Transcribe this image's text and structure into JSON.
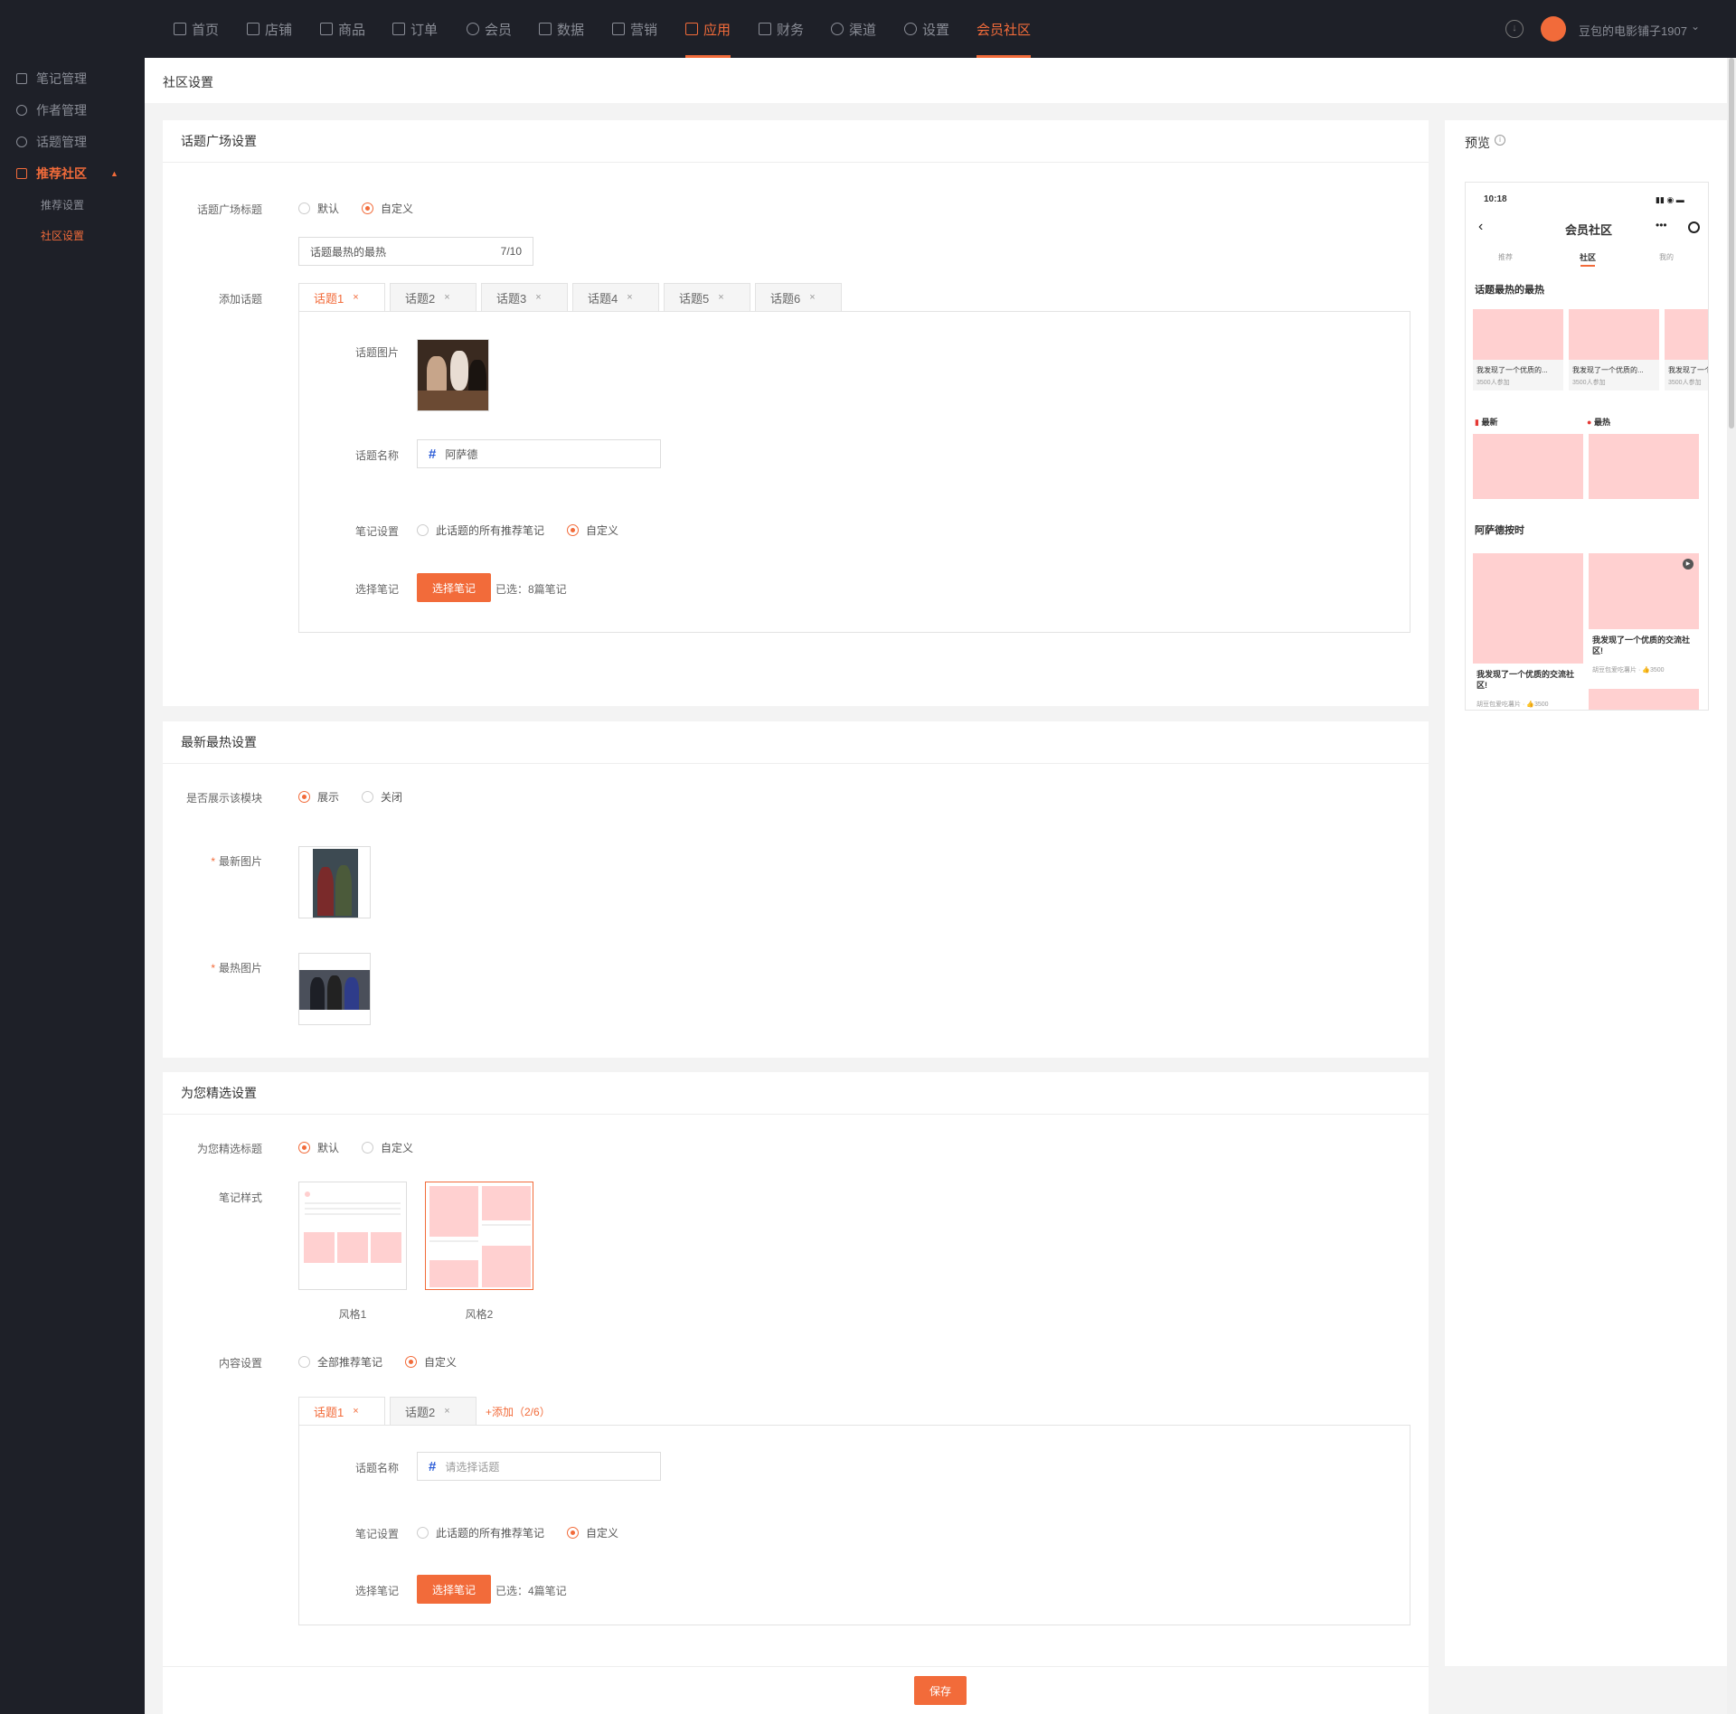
{
  "nav": {
    "items": [
      {
        "label": "首页",
        "icon": "home-icon"
      },
      {
        "label": "店铺",
        "icon": "store-icon"
      },
      {
        "label": "商品",
        "icon": "goods-icon"
      },
      {
        "label": "订单",
        "icon": "order-icon"
      },
      {
        "label": "会员",
        "icon": "member-icon"
      },
      {
        "label": "数据",
        "icon": "chart-icon"
      },
      {
        "label": "营销",
        "icon": "tag-icon"
      },
      {
        "label": "应用",
        "icon": "app-icon"
      },
      {
        "label": "财务",
        "icon": "finance-icon"
      },
      {
        "label": "渠道",
        "icon": "channel-icon"
      },
      {
        "label": "设置",
        "icon": "gear-icon"
      },
      {
        "label": "会员社区",
        "icon": ""
      }
    ],
    "user": "豆包的电影铺子1907",
    "accent": "#f26b3a"
  },
  "sidebar": {
    "items": [
      {
        "label": "笔记管理"
      },
      {
        "label": "作者管理"
      },
      {
        "label": "话题管理"
      },
      {
        "label": "推荐社区"
      }
    ],
    "subs": [
      {
        "label": "推荐设置"
      },
      {
        "label": "社区设置"
      }
    ]
  },
  "page": {
    "title": "社区设置"
  },
  "plaza": {
    "title": "话题广场设置",
    "title_label": "话题广场标题",
    "opt_default": "默认",
    "opt_custom": "自定义",
    "title_value": "话题最热的最热",
    "title_count": "7/10",
    "add_label": "添加话题",
    "tabs": [
      "话题1",
      "话题2",
      "话题3",
      "话题4",
      "话题5",
      "话题6"
    ],
    "img_label": "话题图片",
    "name_label": "话题名称",
    "name_value": "阿萨德",
    "note_label": "笔记设置",
    "note_all": "此话题的所有推荐笔记",
    "note_custom": "自定义",
    "select_label": "选择笔记",
    "select_btn": "选择笔记",
    "selected": "已选：8篇笔记"
  },
  "newhot": {
    "title": "最新最热设置",
    "show_label": "是否展示该模块",
    "show": "展示",
    "close": "关闭",
    "new_img": "最新图片",
    "hot_img": "最热图片"
  },
  "featured": {
    "title": "为您精选设置",
    "title_label": "为您精选标题",
    "opt_default": "默认",
    "opt_custom": "自定义",
    "style_label": "笔记样式",
    "style1": "风格1",
    "style2": "风格2",
    "content_label": "内容设置",
    "content_all": "全部推荐笔记",
    "content_custom": "自定义",
    "tabs": [
      "话题1",
      "话题2"
    ],
    "add": "+添加（2/6）",
    "name_label": "话题名称",
    "name_placeholder": "请选择话题",
    "note_label": "笔记设置",
    "note_all": "此话题的所有推荐笔记",
    "note_custom": "自定义",
    "select_label": "选择笔记",
    "select_btn": "选择笔记",
    "selected": "已选：4篇笔记"
  },
  "save": "保存",
  "preview": {
    "title": "预览",
    "time": "10:18",
    "app_title": "会员社区",
    "tabs": [
      "推荐",
      "社区",
      "我的"
    ],
    "topic_heading": "话题最热的最热",
    "card_text": "我发现了一个优质的...",
    "card_count": "3500人参加",
    "newest": "最新",
    "hottest": "最热",
    "topic2": "阿萨德按时",
    "note_title": "我发现了一个优质的交流社区!",
    "note_author": "胡豆包爱吃薯片",
    "note_likes": "3500"
  }
}
